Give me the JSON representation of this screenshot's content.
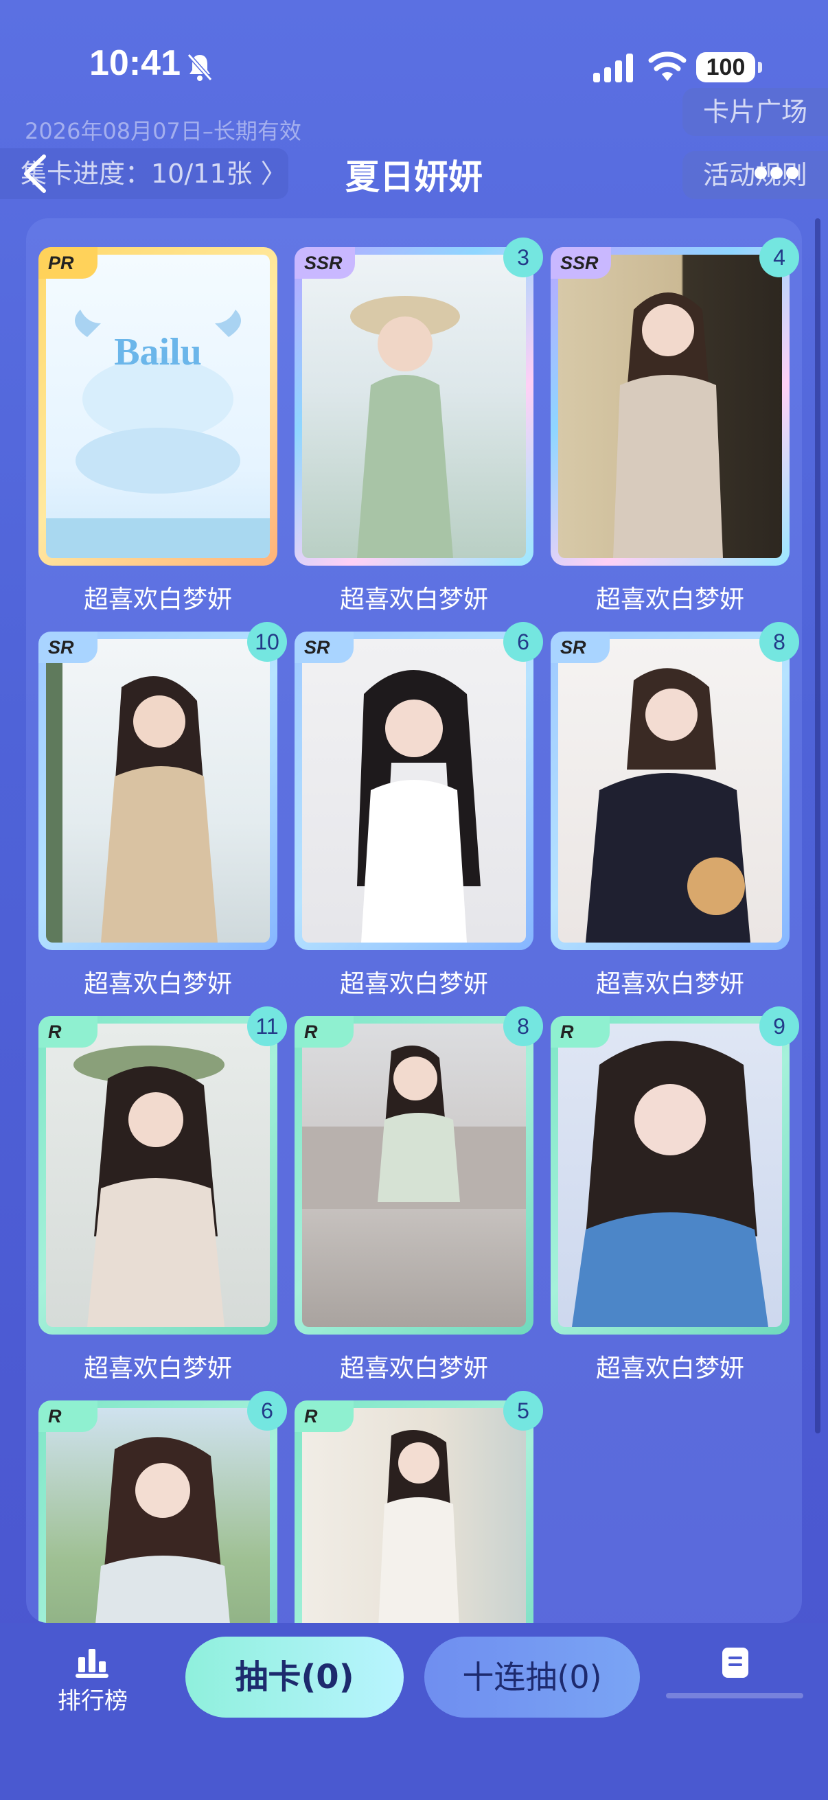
{
  "status": {
    "time": "10:41",
    "battery": "100"
  },
  "header": {
    "validity": "2026年08月07日–长期有效",
    "square_label": "卡片广场",
    "rules_label": "活动规则",
    "progress_label": "集卡进度：10/11张 〉",
    "title": "夏日妍妍"
  },
  "colors": {
    "background": "#5163d8",
    "accent_mint": "#8ff0dc",
    "count_badge": "#74e6e0"
  },
  "cards": [
    {
      "rarity": "PR",
      "count": "",
      "name": "超喜欢白梦妍",
      "art": "Bailu"
    },
    {
      "rarity": "SSR",
      "count": "3",
      "name": "超喜欢白梦妍"
    },
    {
      "rarity": "SSR",
      "count": "4",
      "name": "超喜欢白梦妍"
    },
    {
      "rarity": "SR",
      "count": "10",
      "name": "超喜欢白梦妍"
    },
    {
      "rarity": "SR",
      "count": "6",
      "name": "超喜欢白梦妍"
    },
    {
      "rarity": "SR",
      "count": "8",
      "name": "超喜欢白梦妍"
    },
    {
      "rarity": "R",
      "count": "11",
      "name": "超喜欢白梦妍"
    },
    {
      "rarity": "R",
      "count": "8",
      "name": "超喜欢白梦妍"
    },
    {
      "rarity": "R",
      "count": "9",
      "name": "超喜欢白梦妍"
    },
    {
      "rarity": "R",
      "count": "6",
      "name": ""
    },
    {
      "rarity": "R",
      "count": "5",
      "name": ""
    }
  ],
  "bottom": {
    "ranking_label": "排行榜",
    "draw_label": "抽卡(0)",
    "draw10_label": "十连抽(0)"
  }
}
